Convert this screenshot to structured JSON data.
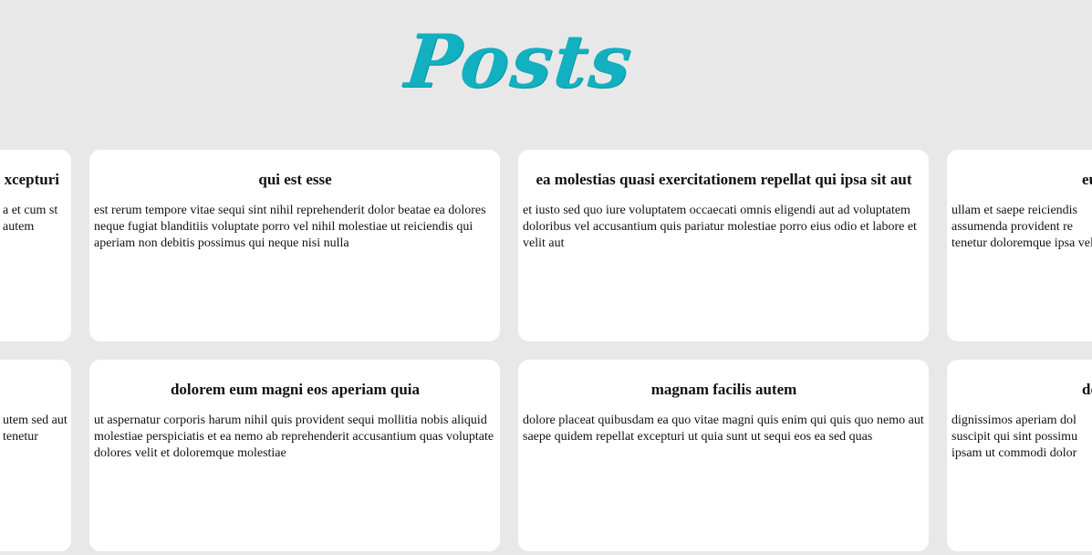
{
  "page": {
    "title": "Posts",
    "accent_color": "#12b0c0",
    "background_color": "#e8e8e8"
  },
  "posts": [
    {
      "title": "xcepturi",
      "body": "a et cum st autem"
    },
    {
      "title": "qui est esse",
      "body": "est rerum tempore vitae sequi sint nihil reprehenderit dolor beatae ea dolores neque fugiat blanditiis voluptate porro vel nihil molestiae ut reiciendis qui aperiam non debitis possimus qui neque nisi nulla"
    },
    {
      "title": "ea molestias quasi exercitationem repellat qui ipsa sit aut",
      "body": "et iusto sed quo iure voluptatem occaecati omnis eligendi aut ad voluptatem doloribus vel accusantium quis pariatur molestiae porro eius odio et labore et velit aut"
    },
    {
      "title": "eu",
      "body": "ullam et saepe reiciendis assumenda provident re tenetur doloremque ipsa velit"
    },
    {
      "title": "",
      "body": "utem sed aut tenetur"
    },
    {
      "title": "dolorem eum magni eos aperiam quia",
      "body": "ut aspernatur corporis harum nihil quis provident sequi mollitia nobis aliquid molestiae perspiciatis et ea nemo ab reprehenderit accusantium quas voluptate dolores velit et doloremque molestiae"
    },
    {
      "title": "magnam facilis autem",
      "body": "dolore placeat quibusdam ea quo vitae magni quis enim qui quis quo nemo aut saepe quidem repellat excepturi ut quia sunt ut sequi eos ea sed quas"
    },
    {
      "title": "dolor",
      "body": "dignissimos aperiam dol suscipit qui sint possimu ipsam ut commodi dolor"
    }
  ]
}
